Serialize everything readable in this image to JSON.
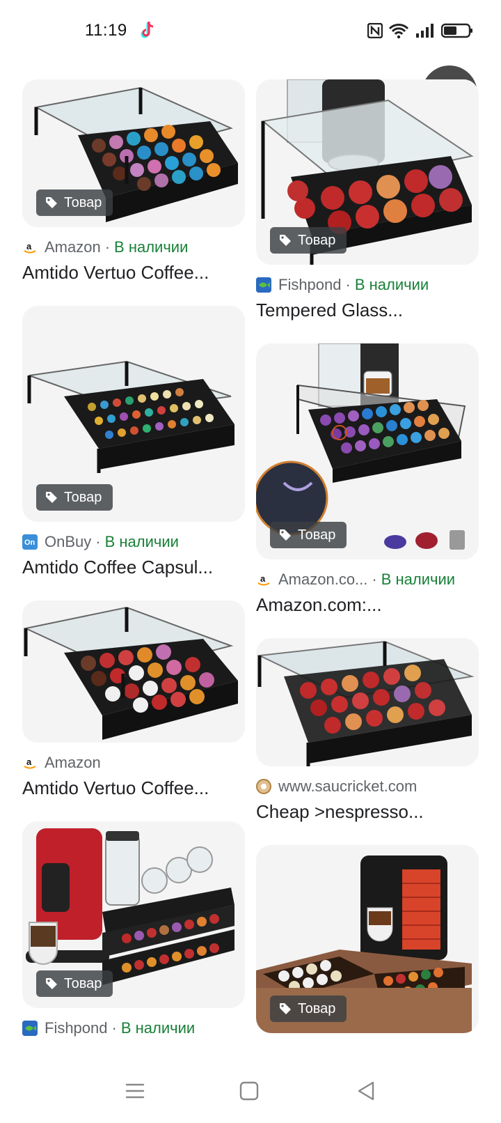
{
  "status_bar": {
    "time": "11:19",
    "icons": [
      "tiktok-icon",
      "nfc-icon",
      "wifi-icon",
      "signal-icon",
      "battery-icon"
    ]
  },
  "close_button": {
    "icon": "close-icon"
  },
  "badge_label": "Товар",
  "left_column": [
    {
      "source": "Amazon",
      "availability": "В наличии",
      "title": "Amtido Vertuo Coffee...",
      "favicon": "amazon-logo",
      "badge": true,
      "image": "glass-top-drawer-with-colored-capsules"
    },
    {
      "source": "OnBuy",
      "availability": "В наличии",
      "title": "Amtido Coffee Capsul...",
      "favicon": "onbuy-logo",
      "badge": true,
      "image": "glass-top-drawer-with-small-capsules"
    },
    {
      "source": "Amazon",
      "availability": "",
      "title": "Amtido Vertuo Coffee...",
      "favicon": "amazon-logo",
      "badge": false,
      "image": "glass-top-drawer-with-dolce-gusto-capsules"
    },
    {
      "source": "Fishpond",
      "availability": "В наличии",
      "title": "",
      "favicon": "fishpond-logo",
      "badge": true,
      "image": "coffee-machine-with-mug-rack-drawer"
    }
  ],
  "right_column": [
    {
      "source": "Fishpond",
      "availability": "В наличии",
      "title": "Tempered Glass...",
      "favicon": "fishpond-logo",
      "badge": true,
      "image": "vertuo-machine-on-glass-drawer"
    },
    {
      "source": "Amazon.co...",
      "availability": "В наличии",
      "title": "Amazon.com:...",
      "favicon": "amazon-logo",
      "badge": true,
      "image": "drawer-with-machine-and-capsules"
    },
    {
      "source": "www.saucricket.com",
      "availability": "",
      "title": "Cheap >nespresso...",
      "favicon": "saucricket-logo",
      "badge": false,
      "image": "glass-drawer-with-red-capsules"
    },
    {
      "source": "",
      "availability": "",
      "title": "",
      "favicon": "",
      "badge": true,
      "image": "red-nespresso-pixie-on-copper-drawer"
    }
  ],
  "colors": {
    "stock_green": "#188038",
    "badge_bg": "#3c4043",
    "card_bg": "#f1f3f4"
  },
  "nav_bar": {
    "icons": [
      "menu-icon",
      "home-icon",
      "back-icon"
    ]
  }
}
